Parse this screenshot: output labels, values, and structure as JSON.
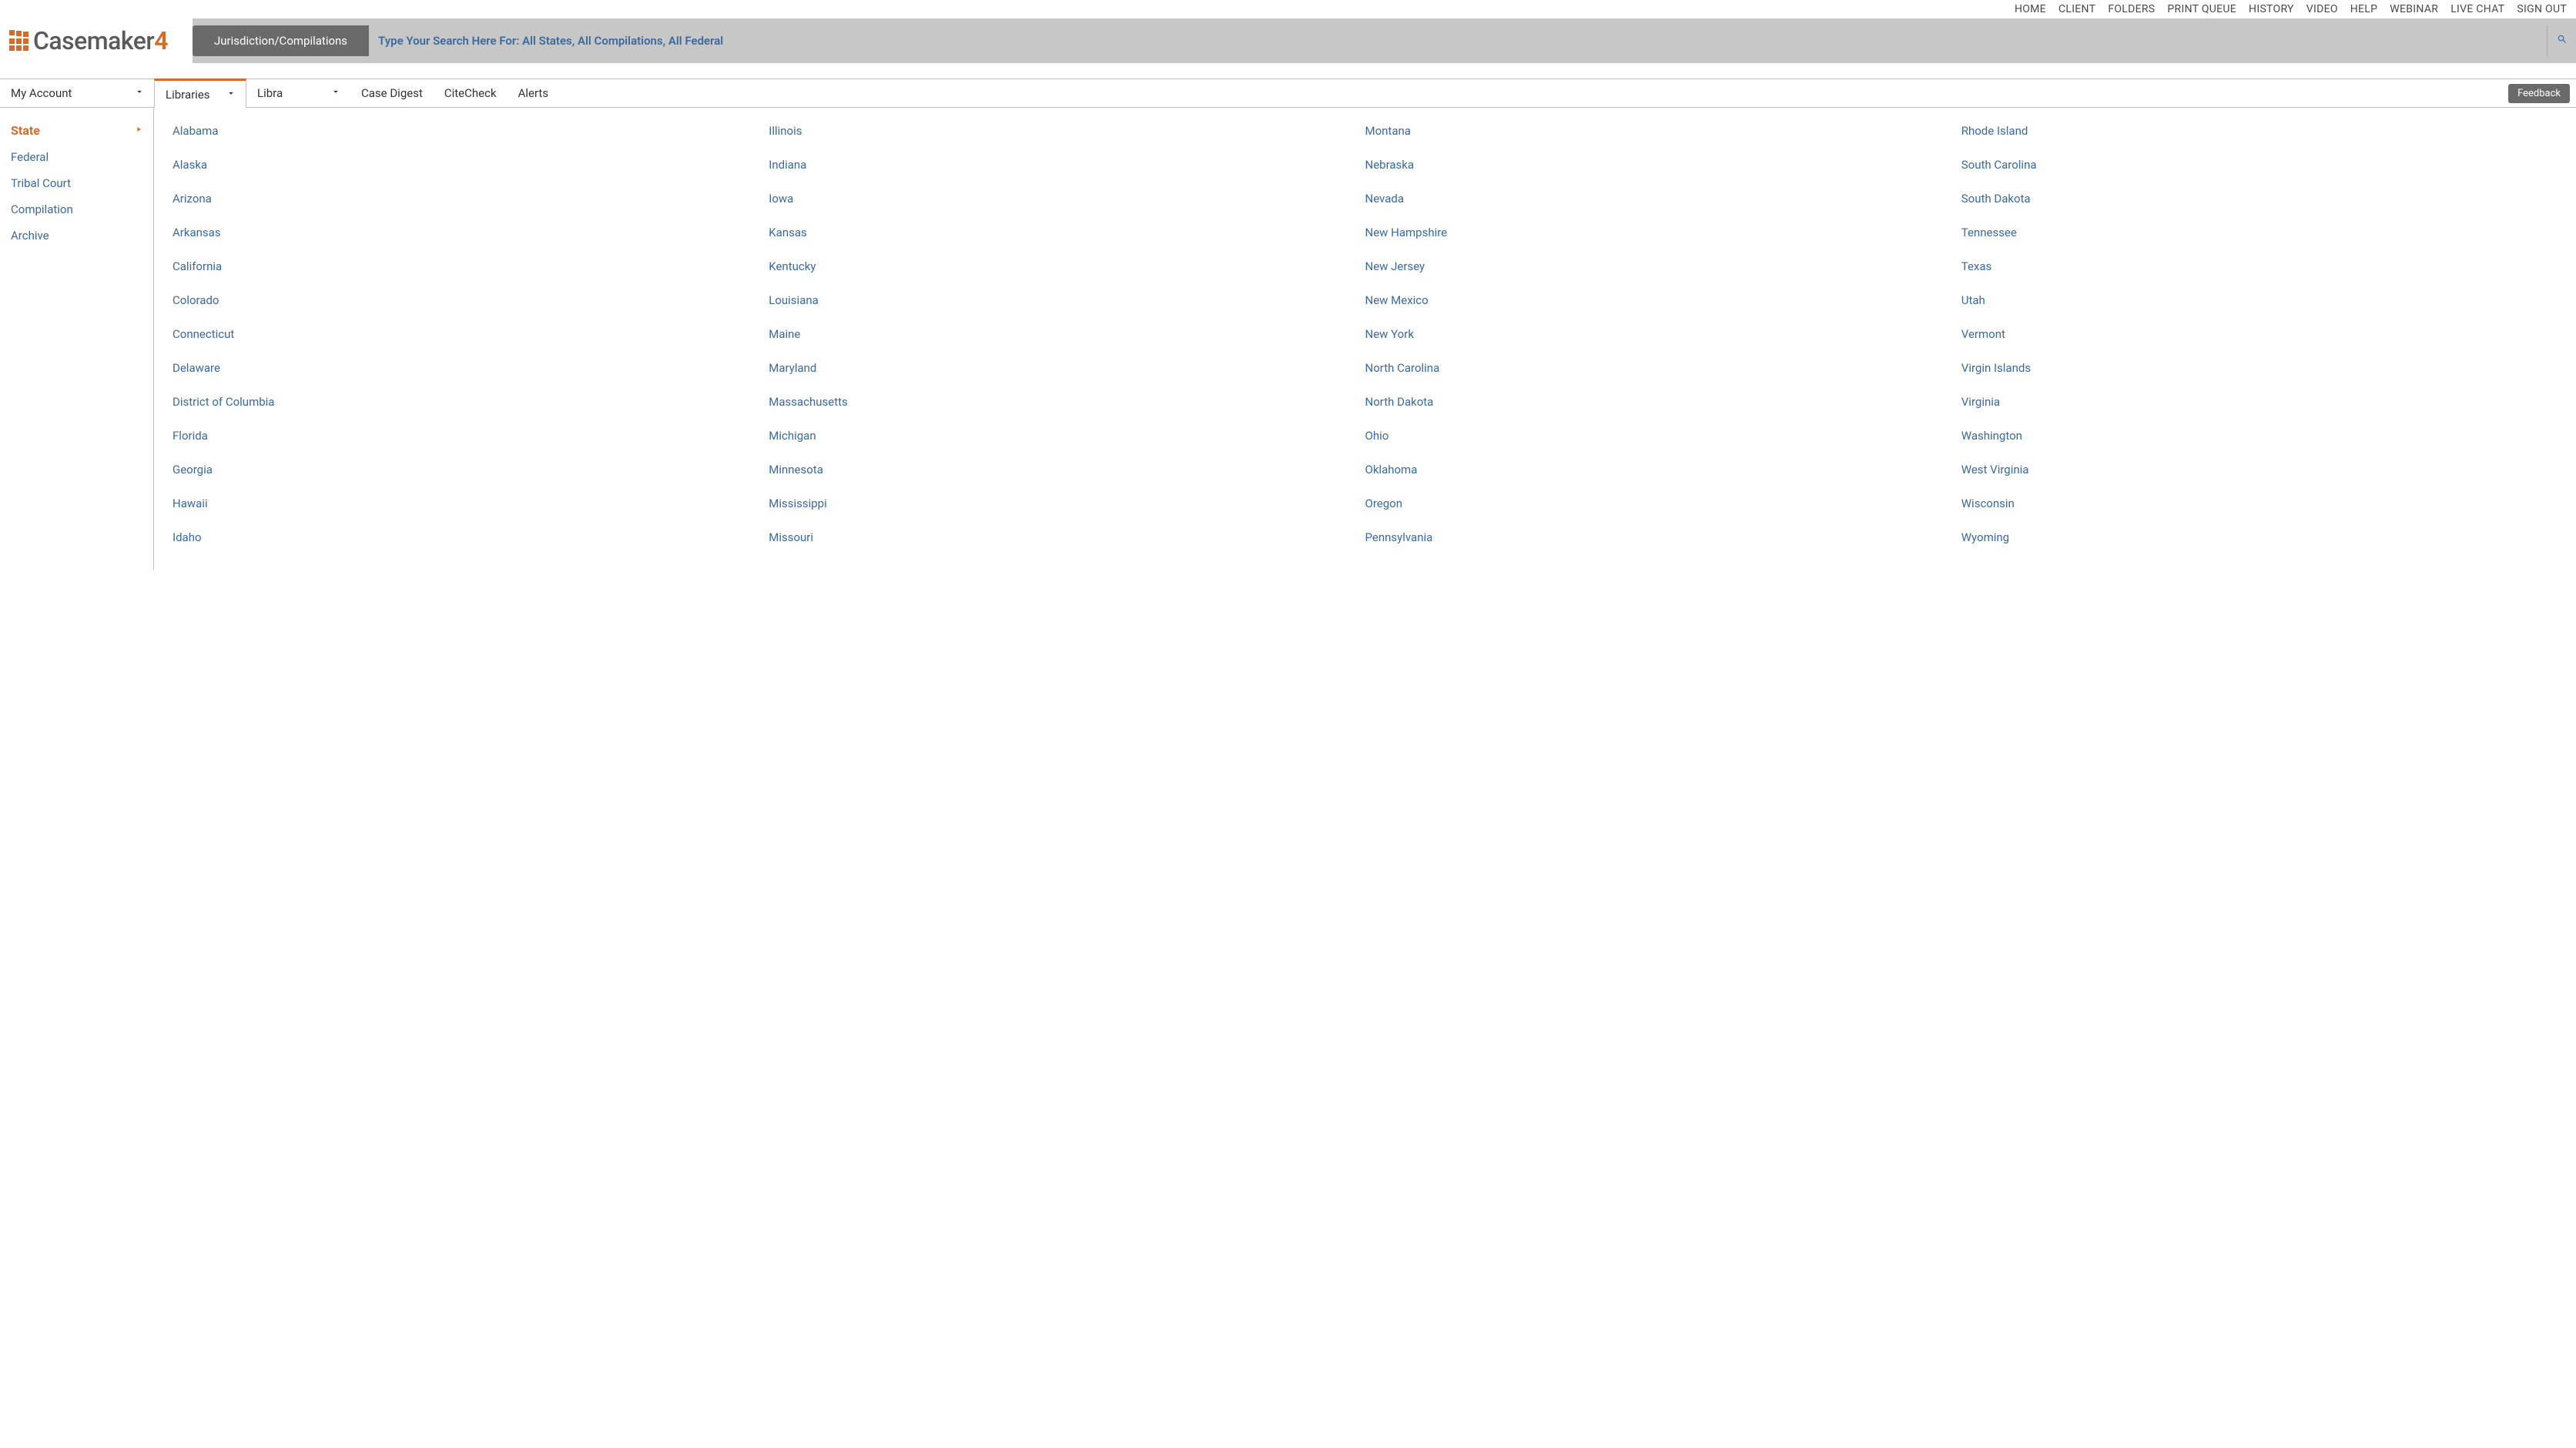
{
  "topNav": {
    "items": [
      "HOME",
      "CLIENT",
      "FOLDERS",
      "PRINT QUEUE",
      "HISTORY",
      "VIDEO",
      "HELP",
      "WEBINAR",
      "LIVE CHAT",
      "SIGN OUT"
    ]
  },
  "logo": {
    "name": "Casemaker",
    "suffix": "4"
  },
  "search": {
    "jurisdictionLabel": "Jurisdiction/Compilations",
    "placeholder": "Type Your Search Here For: All States, All Compilations, All Federal"
  },
  "tabs": {
    "myAccount": "My Account",
    "libraries": "Libraries",
    "libra": "Libra",
    "caseDigest": "Case Digest",
    "citeCheck": "CiteCheck",
    "alerts": "Alerts"
  },
  "feedback": "Feedback",
  "sidebar": {
    "items": [
      {
        "label": "State",
        "active": true
      },
      {
        "label": "Federal",
        "active": false
      },
      {
        "label": "Tribal Court",
        "active": false
      },
      {
        "label": "Compilation",
        "active": false
      },
      {
        "label": "Archive",
        "active": false
      }
    ]
  },
  "states": [
    "Alabama",
    "Alaska",
    "Arizona",
    "Arkansas",
    "California",
    "Colorado",
    "Connecticut",
    "Delaware",
    "District of Columbia",
    "Florida",
    "Georgia",
    "Hawaii",
    "Idaho",
    "Illinois",
    "Indiana",
    "Iowa",
    "Kansas",
    "Kentucky",
    "Louisiana",
    "Maine",
    "Maryland",
    "Massachusetts",
    "Michigan",
    "Minnesota",
    "Mississippi",
    "Missouri",
    "Montana",
    "Nebraska",
    "Nevada",
    "New Hampshire",
    "New Jersey",
    "New Mexico",
    "New York",
    "North Carolina",
    "North Dakota",
    "Ohio",
    "Oklahoma",
    "Oregon",
    "Pennsylvania",
    "Rhode Island",
    "South Carolina",
    "South Dakota",
    "Tennessee",
    "Texas",
    "Utah",
    "Vermont",
    "Virgin Islands",
    "Virginia",
    "Washington",
    "West Virginia",
    "Wisconsin",
    "Wyoming"
  ]
}
